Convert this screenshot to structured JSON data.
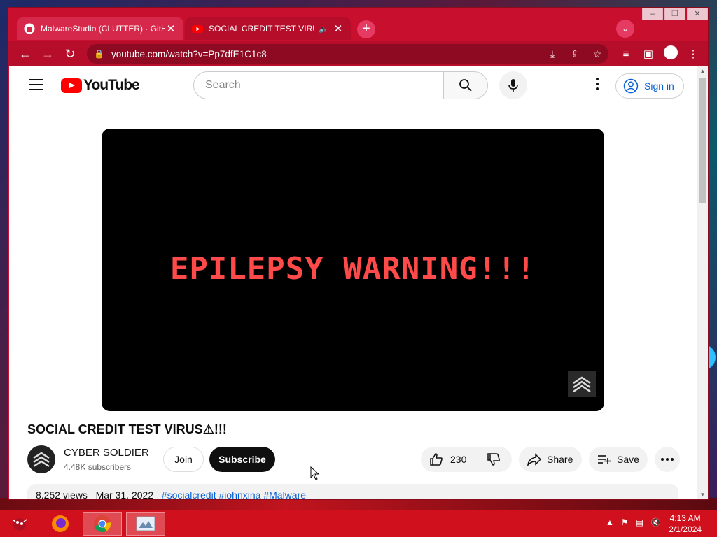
{
  "browser": {
    "tabs": [
      {
        "title": "MalwareStudio (CLUTTER) · GitH",
        "favicon": "github-icon",
        "active": false
      },
      {
        "title": "SOCIAL CREDIT TEST VIRUS⚠",
        "favicon": "youtube-icon",
        "active": true,
        "audio": "speaker-icon"
      }
    ],
    "new_tab_label": "+",
    "tab_search_label": "⌄",
    "window_controls": {
      "minimize": "–",
      "restore": "❐",
      "close": "✕"
    },
    "url": "youtube.com/watch?v=Pp7dfE1C1c8"
  },
  "youtube": {
    "logo_text": "YouTube",
    "search_placeholder": "Search",
    "sign_in_label": "Sign in",
    "video": {
      "overlay_text": "EPILEPSY WARNING!!!",
      "title": "SOCIAL CREDIT TEST VIRUS⚠!!!"
    },
    "channel": {
      "name": "CYBER SOLDIER",
      "subscribers": "4.48K subscribers"
    },
    "buttons": {
      "join": "Join",
      "subscribe": "Subscribe",
      "like_count": "230",
      "share": "Share",
      "save": "Save"
    },
    "description": {
      "views": "8,252 views",
      "date": "Mar 31, 2022",
      "hashtags": [
        "#socialcredit",
        "#johnxina",
        "#Malware"
      ]
    }
  },
  "taskbar": {
    "apps": [
      "bug-icon",
      "firefox-icon",
      "chrome-icon",
      "screenshot-tool-icon"
    ],
    "clock": {
      "time": "4:13 AM",
      "date": "2/1/2024"
    }
  },
  "colors": {
    "window_frame": "#c8102e",
    "youtube_red": "#ff0000",
    "warning_text": "#ff4a4a",
    "link_blue": "#065fd4",
    "taskbar": "#d0101c"
  }
}
